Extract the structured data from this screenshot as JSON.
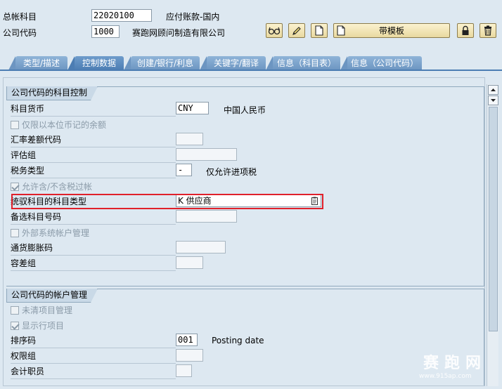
{
  "header": {
    "gl_account_label": "总帐科目",
    "gl_account_value": "22020100",
    "gl_account_desc": "应付账款-国内",
    "company_code_label": "公司代码",
    "company_code_value": "1000",
    "company_code_desc": "赛跑网顾问制造有限公司"
  },
  "toolbar": {
    "template_button_label": "带模板",
    "icons": [
      "glasses-icon",
      "pencil-icon",
      "document-icon",
      "template-document-icon",
      "lock-icon",
      "trash-icon"
    ]
  },
  "tabs": [
    {
      "label": "类型/描述"
    },
    {
      "label": "控制数据"
    },
    {
      "label": "创建/银行/利息"
    },
    {
      "label": "关键字/翻译"
    },
    {
      "label": "信息（科目表）"
    },
    {
      "label": "信息（公司代码）"
    }
  ],
  "group1": {
    "title": "公司代码的科目控制",
    "account_currency_label": "科目货币",
    "account_currency_value": "CNY",
    "account_currency_desc": "中国人民币",
    "balance_local_label": "仅限以本位币记的余额",
    "exchange_rate_label": "汇率差额代码",
    "valuation_group_label": "评估组",
    "tax_category_label": "税务类型",
    "tax_category_value": "-",
    "tax_category_desc": "仅允许进项税",
    "posting_without_tax_label": "允许含/不含税过帐",
    "recon_account_label": "统驭科目的科目类型",
    "recon_account_value": "K 供应商",
    "alt_account_label": "备选科目号码",
    "external_mgmt_label": "外部系统帐户管理",
    "inflation_label": "通货膨胀码",
    "tolerance_label": "容差组"
  },
  "group2": {
    "title": "公司代码的帐户管理",
    "open_item_label": "未清项目管理",
    "line_item_label": "显示行项目",
    "sort_key_label": "排序码",
    "sort_key_value": "001",
    "sort_key_desc": "Posting date",
    "auth_group_label": "权限组",
    "accounting_clerk_label": "会计职员"
  },
  "watermark": {
    "text": "赛跑网",
    "url": "www.915ap.com"
  }
}
